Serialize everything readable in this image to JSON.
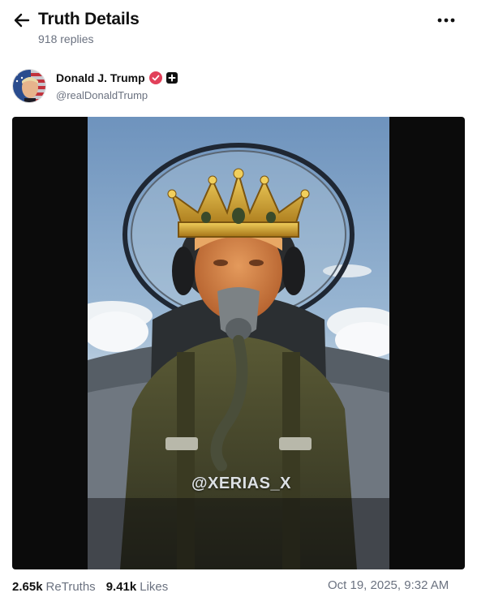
{
  "header": {
    "title": "Truth Details",
    "replies": "918 replies",
    "back_icon": "arrow-left-icon",
    "more_icon": "ellipsis-icon"
  },
  "author": {
    "name": "Donald J. Trump",
    "handle": "@realDonaldTrump",
    "verified_color": "#e2405a"
  },
  "media": {
    "watermark": "@XERIAS_X"
  },
  "stats": {
    "retruths_count": "2.65k",
    "retruths_label": "ReTruths",
    "likes_count": "9.41k",
    "likes_label": "Likes",
    "timestamp": "Oct 19, 2025, 9:32 AM"
  }
}
